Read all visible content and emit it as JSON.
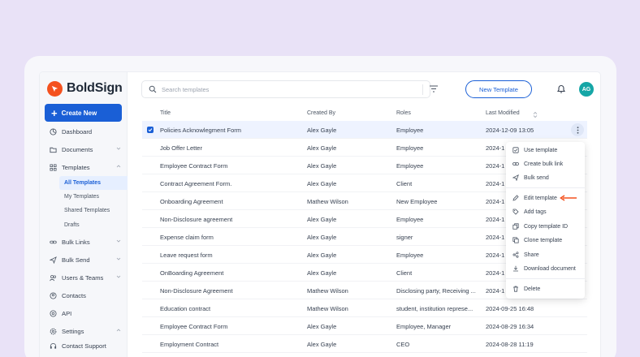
{
  "brand": {
    "name": "BoldSign",
    "color": "#f4511e"
  },
  "sidebar": {
    "create_label": "Create New",
    "items": [
      {
        "label": "Dashboard",
        "icon": "dashboard-icon"
      },
      {
        "label": "Documents",
        "icon": "folder-icon"
      },
      {
        "label": "Templates",
        "icon": "grid-icon"
      },
      {
        "label": "Bulk Links",
        "icon": "link-icon"
      },
      {
        "label": "Bulk Send",
        "icon": "send-icon"
      },
      {
        "label": "Users & Teams",
        "icon": "users-icon"
      },
      {
        "label": "Contacts",
        "icon": "contact-icon"
      },
      {
        "label": "API",
        "icon": "api-icon"
      },
      {
        "label": "Settings",
        "icon": "gear-icon"
      },
      {
        "label": "Contact Support",
        "icon": "headset-icon"
      }
    ],
    "template_sub": [
      "All Templates",
      "My Templates",
      "Shared Templates",
      "Drafts"
    ],
    "active_sub": "All Templates"
  },
  "header": {
    "search_placeholder": "Search templates",
    "new_template_label": "New Template",
    "avatar_initials": "AG"
  },
  "table": {
    "columns": [
      "Title",
      "Created By",
      "Roles",
      "Last Modified"
    ],
    "rows": [
      {
        "title": "Policies Acknowlegment Form",
        "created_by": "Alex Gayle",
        "roles": "Employee",
        "modified": "2024-12-09 13:05"
      },
      {
        "title": "Job Offer Letter",
        "created_by": "Alex Gayle",
        "roles": "Employee",
        "modified": "2024-1"
      },
      {
        "title": "Employee Contract Form",
        "created_by": "Alex Gayle",
        "roles": "Employee",
        "modified": "2024-1"
      },
      {
        "title": "Contract Agreement Form.",
        "created_by": "Alex Gayle",
        "roles": "Client",
        "modified": "2024-1"
      },
      {
        "title": "Onboarding Agreement",
        "created_by": "Mathew Wilson",
        "roles": "New Employee",
        "modified": "2024-1"
      },
      {
        "title": "Non-Disclosure agreement",
        "created_by": "Alex Gayle",
        "roles": "Employee",
        "modified": "2024-1"
      },
      {
        "title": "Expense claim form",
        "created_by": "Alex Gayle",
        "roles": "signer",
        "modified": "2024-1"
      },
      {
        "title": "Leave request form",
        "created_by": "Alex Gayle",
        "roles": "Employee",
        "modified": "2024-1"
      },
      {
        "title": "OnBoarding Agreement",
        "created_by": "Alex Gayle",
        "roles": "Client",
        "modified": "2024-1"
      },
      {
        "title": "Non-Disclosure Agreement",
        "created_by": "Mathew Wilson",
        "roles": "Disclosing party, Receiving ...",
        "modified": "2024-1"
      },
      {
        "title": "Education contract",
        "created_by": "Mathew Wilson",
        "roles": "student, institution represe...",
        "modified": "2024-09-25 16:48"
      },
      {
        "title": "Employee Contract Form",
        "created_by": "Alex Gayle",
        "roles": "Employee, Manager",
        "modified": "2024-08-29 16:34"
      },
      {
        "title": "Employment Contract",
        "created_by": "Alex Gayle",
        "roles": "CEO",
        "modified": "2024-08-28 11:19"
      }
    ]
  },
  "context_menu": {
    "items": [
      {
        "label": "Use template",
        "icon": "use-template-icon"
      },
      {
        "label": "Create bulk link",
        "icon": "link-icon"
      },
      {
        "label": "Bulk send",
        "icon": "send-icon"
      },
      {
        "label": "Edit template",
        "icon": "pencil-icon"
      },
      {
        "label": "Add tags",
        "icon": "tag-icon"
      },
      {
        "label": "Copy template ID",
        "icon": "copy-icon"
      },
      {
        "label": "Clone template",
        "icon": "clone-icon"
      },
      {
        "label": "Share",
        "icon": "share-icon"
      },
      {
        "label": "Download document",
        "icon": "download-icon"
      },
      {
        "label": "Delete",
        "icon": "trash-icon"
      }
    ]
  },
  "colors": {
    "primary": "#1a5fd6",
    "accent_arrow": "#f4511e",
    "avatar": "#15a6a6",
    "background": "#e9e2f7"
  }
}
